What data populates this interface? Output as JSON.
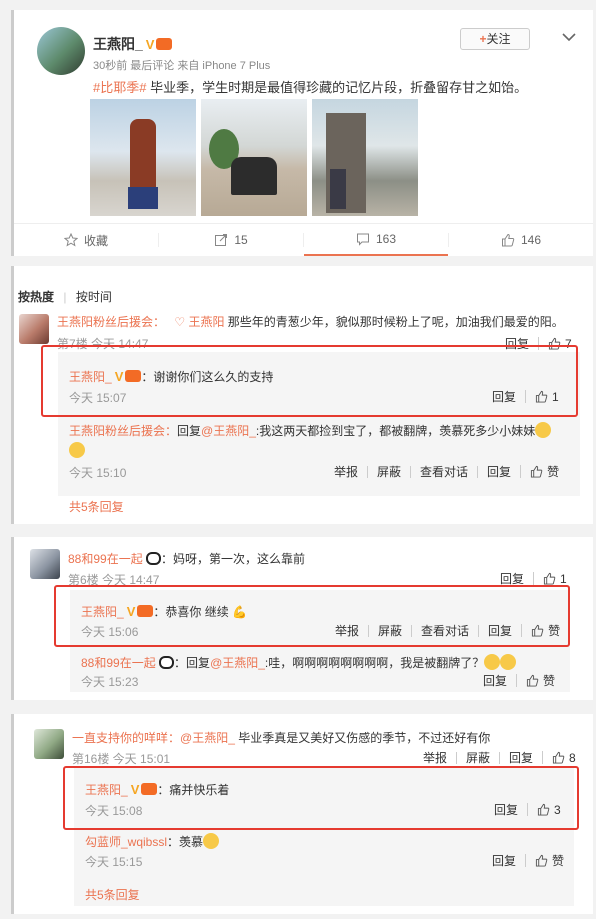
{
  "post": {
    "author": "王燕阳_",
    "verified_mark": "V",
    "meta_time": "30秒前 最后评论",
    "meta_source": "来自 iPhone 7 Plus",
    "hashtag": "#比耶季#",
    "text": " 毕业季，学生时期是最值得珍藏的记忆片段，折叠留存甘之如饴。",
    "follow_label": "关注",
    "actions": {
      "favorite": "收藏",
      "repost": "15",
      "comment": "163",
      "like": "146"
    }
  },
  "sort": {
    "hot": "按热度",
    "time": "按时间"
  },
  "threads": [
    {
      "author": "王燕阳粉丝后援会：",
      "mention": "王燕阳",
      "text": " 那些年的青葱少年，貌似那时候粉上了呢，加油我们最爱的阳。",
      "floor": "第7楼 今天 14:47",
      "reply": "回复",
      "likes": "7",
      "replies": [
        {
          "author": "王燕阳_",
          "text": "：谢谢你们这么久的支持",
          "time": "今天 15:07",
          "reply": "回复",
          "likes": "1"
        },
        {
          "author": "王燕阳粉丝后援会：",
          "text_prefix": "回复",
          "mention": "@王燕阳_",
          "text": ":我这两天都捡到宝了，都被翻牌，羡慕死多少小妹妹",
          "time": "今天 15:10",
          "ops": [
            "举报",
            "屏蔽",
            "查看对话",
            "回复"
          ],
          "like": "赞"
        }
      ],
      "more": "共5条回复"
    },
    {
      "author": "88和99在一起",
      "text": "：妈呀，第一次，这么靠前",
      "floor": "第6楼 今天 14:47",
      "reply": "回复",
      "likes": "1",
      "replies": [
        {
          "author": "王燕阳_",
          "text": "：恭喜你 继续",
          "time": "今天 15:06",
          "ops": [
            "举报",
            "屏蔽",
            "查看对话",
            "回复"
          ],
          "like": "赞"
        },
        {
          "author": "88和99在一起",
          "text_prefix": "：回复",
          "mention": "@王燕阳_",
          "text": ":哇，啊啊啊啊啊啊啊啊，我是被翻牌了？",
          "time": "今天 15:23",
          "reply": "回复",
          "like": "赞"
        }
      ]
    },
    {
      "author": "一直支持你的咩咩：",
      "mention": "@王燕阳_",
      "text": " 毕业季真是又美好又伤感的季节，不过还好有你",
      "floor": "第16楼 今天 15:01",
      "ops": [
        "举报",
        "屏蔽",
        "回复"
      ],
      "likes": "8",
      "replies": [
        {
          "author": "王燕阳_",
          "text": "：痛并快乐着",
          "time": "今天 15:08",
          "reply": "回复",
          "likes": "3"
        },
        {
          "author": "勾蓝师_wqibssl",
          "text": "：羡慕",
          "time": "今天 15:15",
          "reply": "回复",
          "like": "赞"
        }
      ],
      "more": "共5条回复"
    }
  ],
  "colors": {
    "accent": "#eb7350",
    "highlight_box": "#e53a30",
    "link": "#eb7350"
  }
}
